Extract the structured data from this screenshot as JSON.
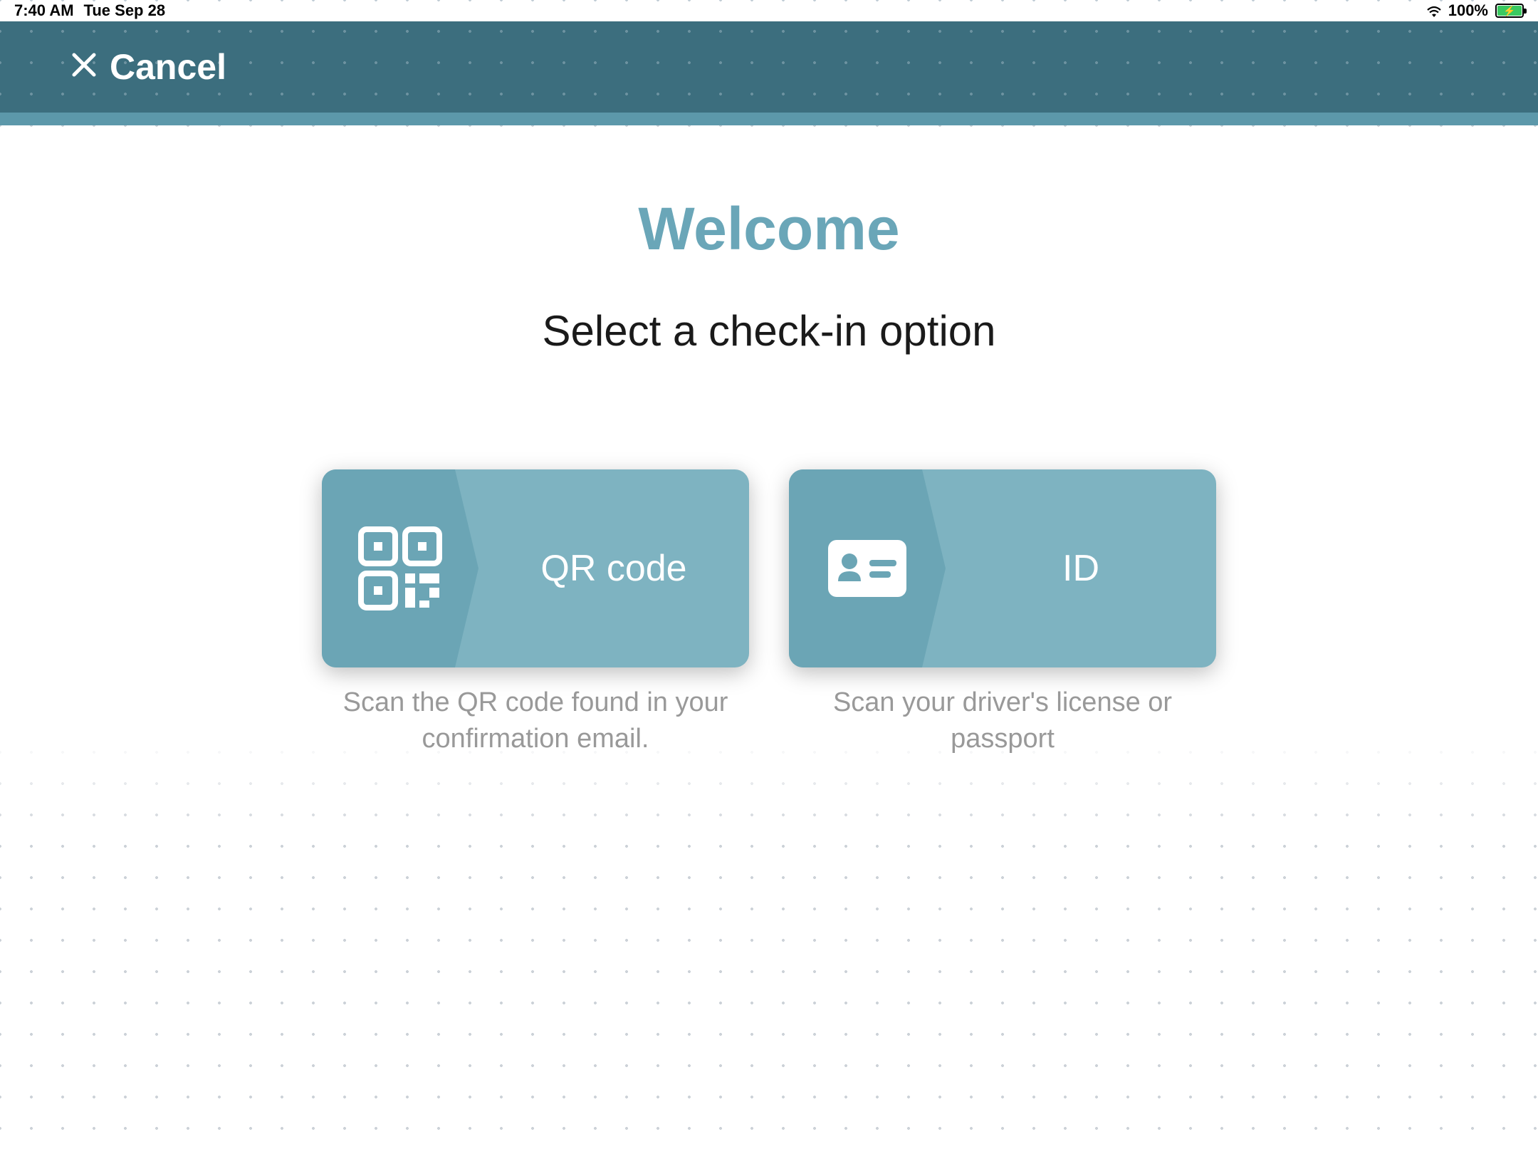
{
  "statusBar": {
    "time": "7:40 AM",
    "date": "Tue Sep 28",
    "batteryPercent": "100%"
  },
  "header": {
    "cancelLabel": "Cancel"
  },
  "main": {
    "welcome": "Welcome",
    "subtitle": "Select a check-in option"
  },
  "options": {
    "qr": {
      "label": "QR code",
      "description": "Scan the QR code found in your confirmation email."
    },
    "id": {
      "label": "ID",
      "description": "Scan your driver's license or passport"
    }
  },
  "colors": {
    "headerBg": "#3c6e7e",
    "accent": "#5c98aa",
    "titleColor": "#6aa6b8",
    "cardDark": "#6ba5b5",
    "cardLight": "#7eb3c1"
  }
}
